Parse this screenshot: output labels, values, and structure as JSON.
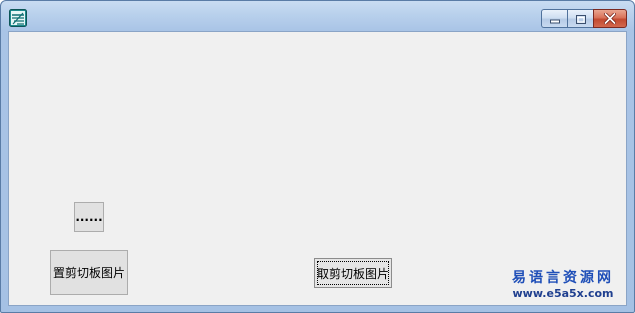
{
  "window": {
    "title": "",
    "icons": {
      "app": "app-logo-icon",
      "minimize": "minimize-icon",
      "maximize": "maximize-icon",
      "close": "close-icon"
    },
    "colors": {
      "client_background": "#f0f0f0",
      "close_button": "#c9472e",
      "watermark_text": "#1f4fb8"
    }
  },
  "buttons": {
    "ellipsis_label": "......",
    "set_clipboard_image_label": "置剪切板图片",
    "get_clipboard_image_label": "取剪切板图片"
  },
  "watermark": {
    "chinese": "易语言资源网",
    "url": "www.e5a5x.com"
  }
}
